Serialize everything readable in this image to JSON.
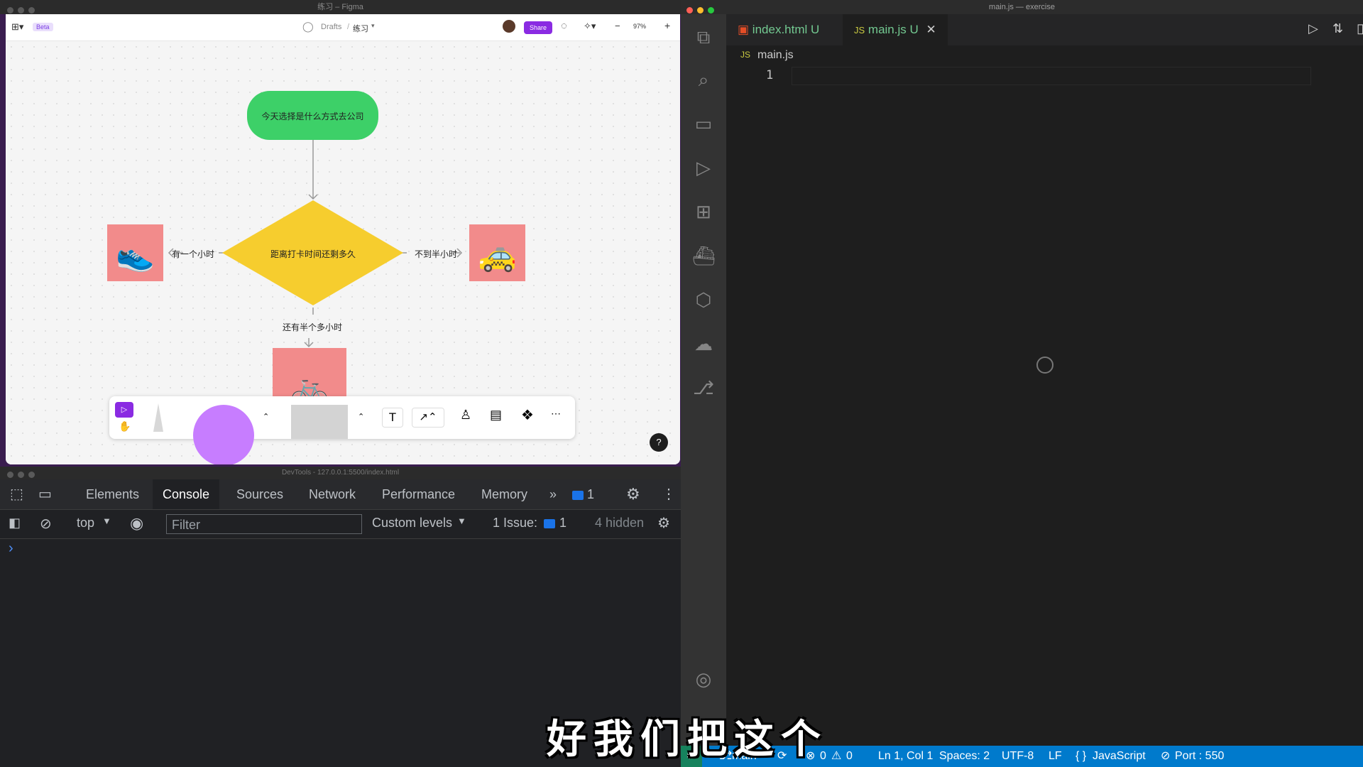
{
  "figma": {
    "window_title": "练习 – Figma",
    "beta": "Beta",
    "breadcrumb_drafts": "Drafts",
    "breadcrumb_sep": "/",
    "file_name": "练习",
    "share": "Share",
    "zoom": "97%",
    "minus": "−",
    "plus": "+",
    "help": "?",
    "flow": {
      "start": "今天选择是什么方式去公司",
      "decision": "距离打卡时间还剩多久",
      "left_label": "有一个小时",
      "right_label": "不到半小时",
      "bottom_label": "还有半个多小时",
      "left_emoji": "👟",
      "right_emoji": "🚕",
      "bottom_emoji": "🚲"
    },
    "colors": {
      "start": "#3dd068",
      "decision": "#f6cd2e",
      "pink": "#f28b8b",
      "purple": "#c77dff",
      "share": "#8a2be2"
    }
  },
  "devtools": {
    "window_title": "DevTools - 127.0.0.1:5500/index.html",
    "tabs": [
      "Elements",
      "Console",
      "Sources",
      "Network",
      "Performance",
      "Memory"
    ],
    "more": "»",
    "issues_count": "1",
    "context": "top",
    "filter_placeholder": "Filter",
    "levels": "Custom levels",
    "issues_label": "1 Issue:",
    "issues_num": "1",
    "hidden": "4 hidden",
    "prompt": "›"
  },
  "vscode": {
    "window_title": "main.js — exercise",
    "tabs": [
      {
        "name": "index.html",
        "status": "U"
      },
      {
        "name": "main.js",
        "status": "U"
      }
    ],
    "breadcrumb": "main.js",
    "line_number": "1",
    "status": {
      "branch": "main*",
      "errors": "0",
      "warnings": "0",
      "position": "Ln 1, Col 1",
      "spaces": "Spaces: 2",
      "encoding": "UTF-8",
      "eol": "LF",
      "language": "JavaScript",
      "port": "Port : 550"
    }
  },
  "subtitle": "好我们把这个"
}
